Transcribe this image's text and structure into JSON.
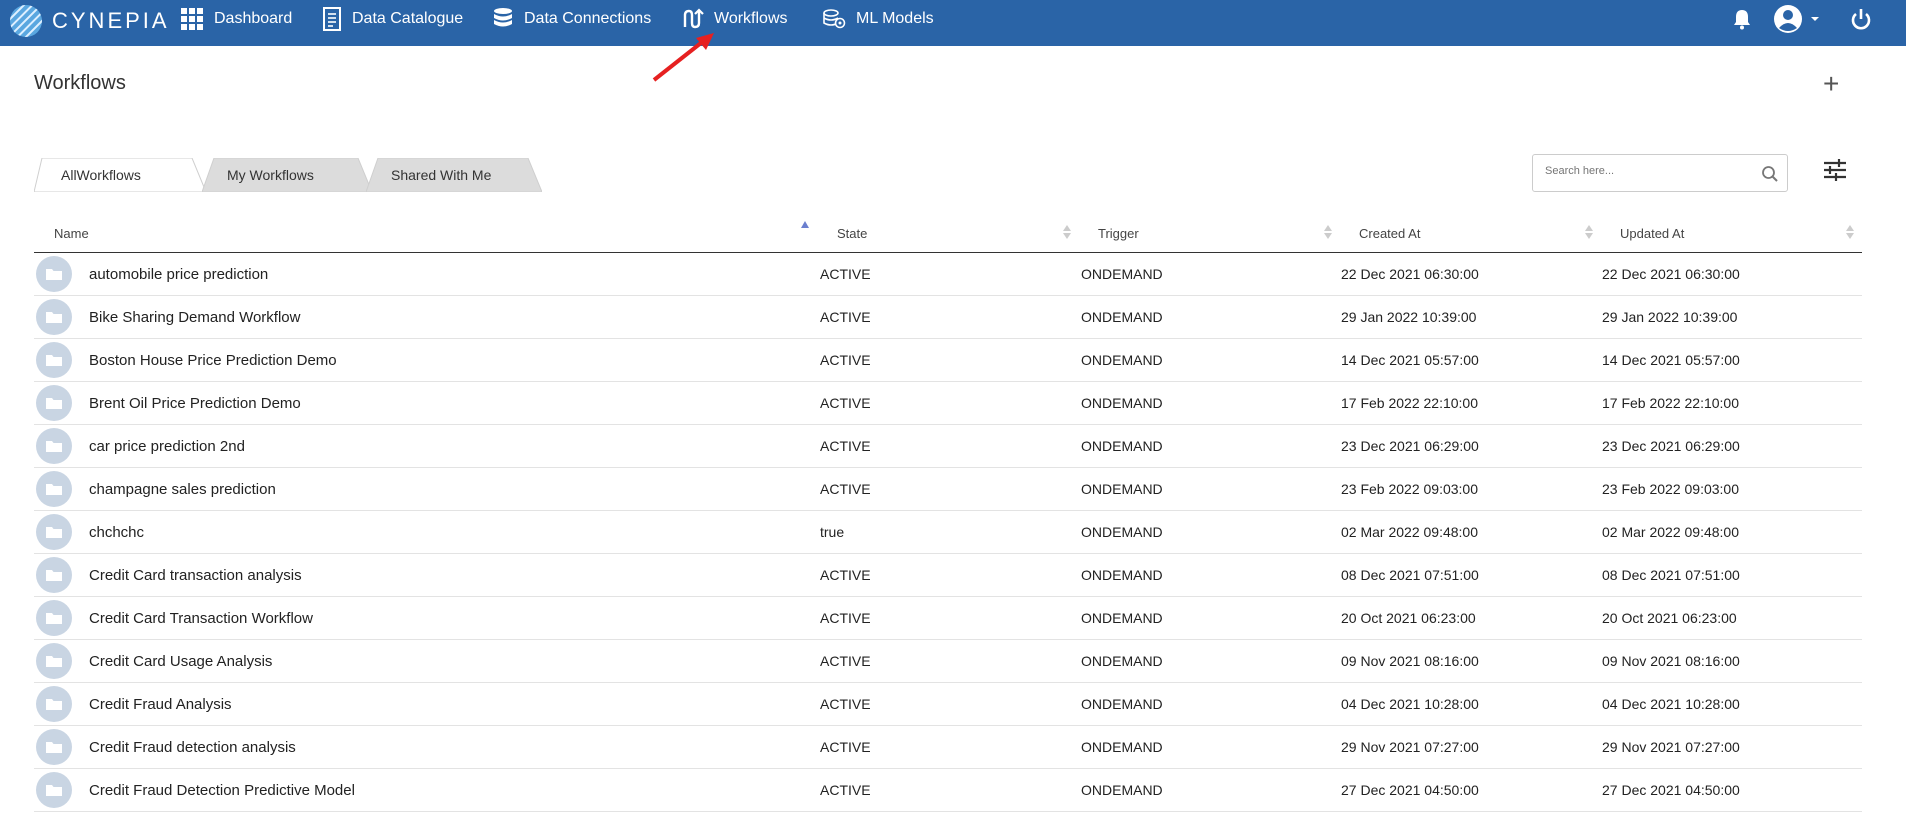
{
  "app": {
    "logo_text": "CYNEPIA"
  },
  "nav": {
    "items": [
      {
        "label": "Dashboard",
        "icon": "grid-icon"
      },
      {
        "label": "Data Catalogue",
        "icon": "document-icon"
      },
      {
        "label": "Data Connections",
        "icon": "database-icon"
      },
      {
        "label": "Workflows",
        "icon": "workflow-icon"
      },
      {
        "label": "ML Models",
        "icon": "ml-models-icon"
      }
    ],
    "right_icons": [
      "bell-icon",
      "user-account-icon",
      "power-icon"
    ]
  },
  "page": {
    "title": "Workflows",
    "add_symbol": "+"
  },
  "tabs": [
    {
      "label": "AllWorkflows",
      "active": true
    },
    {
      "label": "My Workflows",
      "active": false
    },
    {
      "label": "Shared With Me",
      "active": false
    }
  ],
  "search": {
    "placeholder": "Search here..."
  },
  "table": {
    "columns": [
      "Name",
      "State",
      "Trigger",
      "Created At",
      "Updated At"
    ],
    "rows": [
      {
        "name": "automobile price prediction",
        "state": "ACTIVE",
        "trigger": "ONDEMAND",
        "created": "22 Dec 2021 06:30:00",
        "updated": "22 Dec 2021 06:30:00"
      },
      {
        "name": "Bike Sharing Demand Workflow",
        "state": "ACTIVE",
        "trigger": "ONDEMAND",
        "created": "29 Jan 2022 10:39:00",
        "updated": "29 Jan 2022 10:39:00"
      },
      {
        "name": "Boston House Price Prediction Demo",
        "state": "ACTIVE",
        "trigger": "ONDEMAND",
        "created": "14 Dec 2021 05:57:00",
        "updated": "14 Dec 2021 05:57:00"
      },
      {
        "name": "Brent Oil Price Prediction Demo",
        "state": "ACTIVE",
        "trigger": "ONDEMAND",
        "created": "17 Feb 2022 22:10:00",
        "updated": "17 Feb 2022 22:10:00"
      },
      {
        "name": "car price prediction 2nd",
        "state": "ACTIVE",
        "trigger": "ONDEMAND",
        "created": "23 Dec 2021 06:29:00",
        "updated": "23 Dec 2021 06:29:00"
      },
      {
        "name": "champagne sales prediction",
        "state": "ACTIVE",
        "trigger": "ONDEMAND",
        "created": "23 Feb 2022 09:03:00",
        "updated": "23 Feb 2022 09:03:00"
      },
      {
        "name": "chchchc",
        "state": "true",
        "trigger": "ONDEMAND",
        "created": "02 Mar 2022 09:48:00",
        "updated": "02 Mar 2022 09:48:00"
      },
      {
        "name": "Credit Card transaction analysis",
        "state": "ACTIVE",
        "trigger": "ONDEMAND",
        "created": "08 Dec 2021 07:51:00",
        "updated": "08 Dec 2021 07:51:00"
      },
      {
        "name": "Credit Card Transaction Workflow",
        "state": "ACTIVE",
        "trigger": "ONDEMAND",
        "created": "20 Oct 2021 06:23:00",
        "updated": "20 Oct 2021 06:23:00"
      },
      {
        "name": "Credit Card Usage Analysis",
        "state": "ACTIVE",
        "trigger": "ONDEMAND",
        "created": "09 Nov 2021 08:16:00",
        "updated": "09 Nov 2021 08:16:00"
      },
      {
        "name": "Credit Fraud Analysis",
        "state": "ACTIVE",
        "trigger": "ONDEMAND",
        "created": "04 Dec 2021 10:28:00",
        "updated": "04 Dec 2021 10:28:00"
      },
      {
        "name": "Credit Fraud detection analysis",
        "state": "ACTIVE",
        "trigger": "ONDEMAND",
        "created": "29 Nov 2021 07:27:00",
        "updated": "29 Nov 2021 07:27:00"
      },
      {
        "name": "Credit Fraud Detection Predictive Model",
        "state": "ACTIVE",
        "trigger": "ONDEMAND",
        "created": "27 Dec 2021 04:50:00",
        "updated": "27 Dec 2021 04:50:00"
      }
    ]
  },
  "colors": {
    "topbar": "#2a64a7",
    "annotation_arrow": "#e62020",
    "folder_badge": "#c9d5e3"
  }
}
